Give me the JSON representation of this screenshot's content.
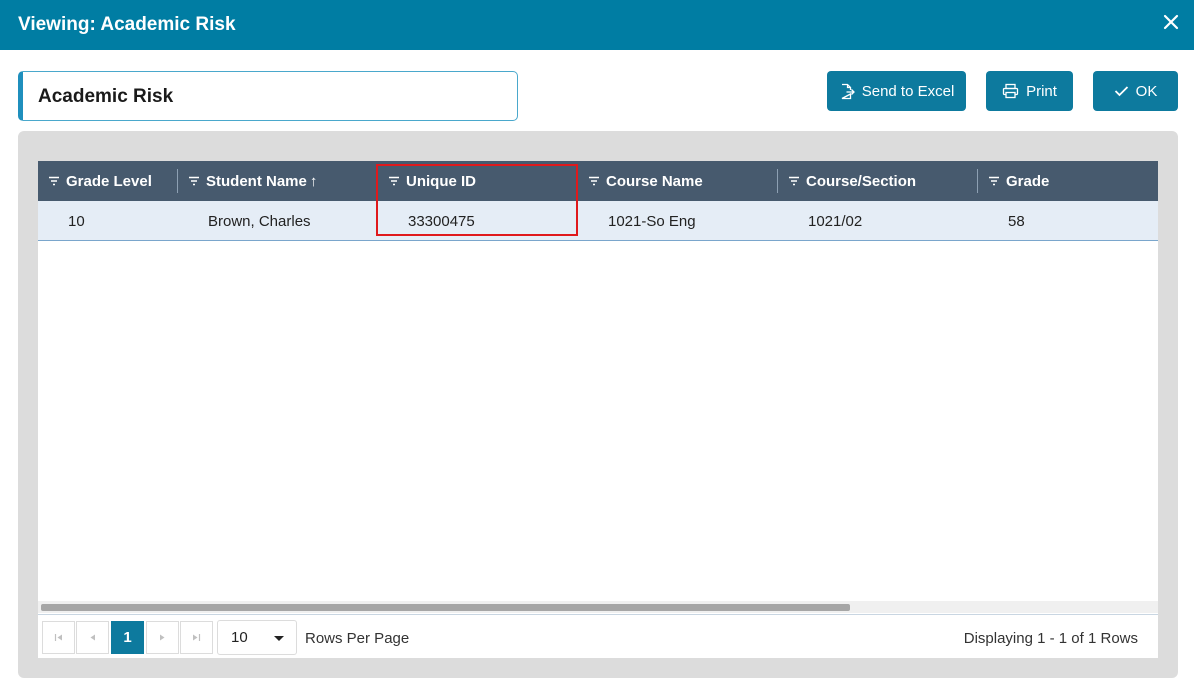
{
  "window": {
    "title": "Viewing: Academic Risk"
  },
  "report": {
    "name": "Academic Risk"
  },
  "toolbar": {
    "send_to_excel": "Send to Excel",
    "print": "Print",
    "ok": "OK"
  },
  "columns": [
    {
      "label": "Grade Level"
    },
    {
      "label": "Student Name",
      "sort": "↑"
    },
    {
      "label": "Unique ID"
    },
    {
      "label": "Course Name"
    },
    {
      "label": "Course/Section"
    },
    {
      "label": "Grade"
    }
  ],
  "rows": [
    {
      "grade_level": "10",
      "student_name": "Brown, Charles",
      "unique_id": "33300475",
      "course_name": "1021-So Eng",
      "course_section": "1021/02",
      "grade": "58"
    }
  ],
  "pager": {
    "current_page": "1",
    "rows_per_page": "10",
    "rows_per_page_label": "Rows Per Page",
    "display_text": "Displaying 1 - 1 of 1 Rows"
  },
  "colors": {
    "titlebar": "#007da3",
    "header": "#475a6e",
    "accent": "#0d7a9e",
    "highlight": "#e0191c"
  }
}
